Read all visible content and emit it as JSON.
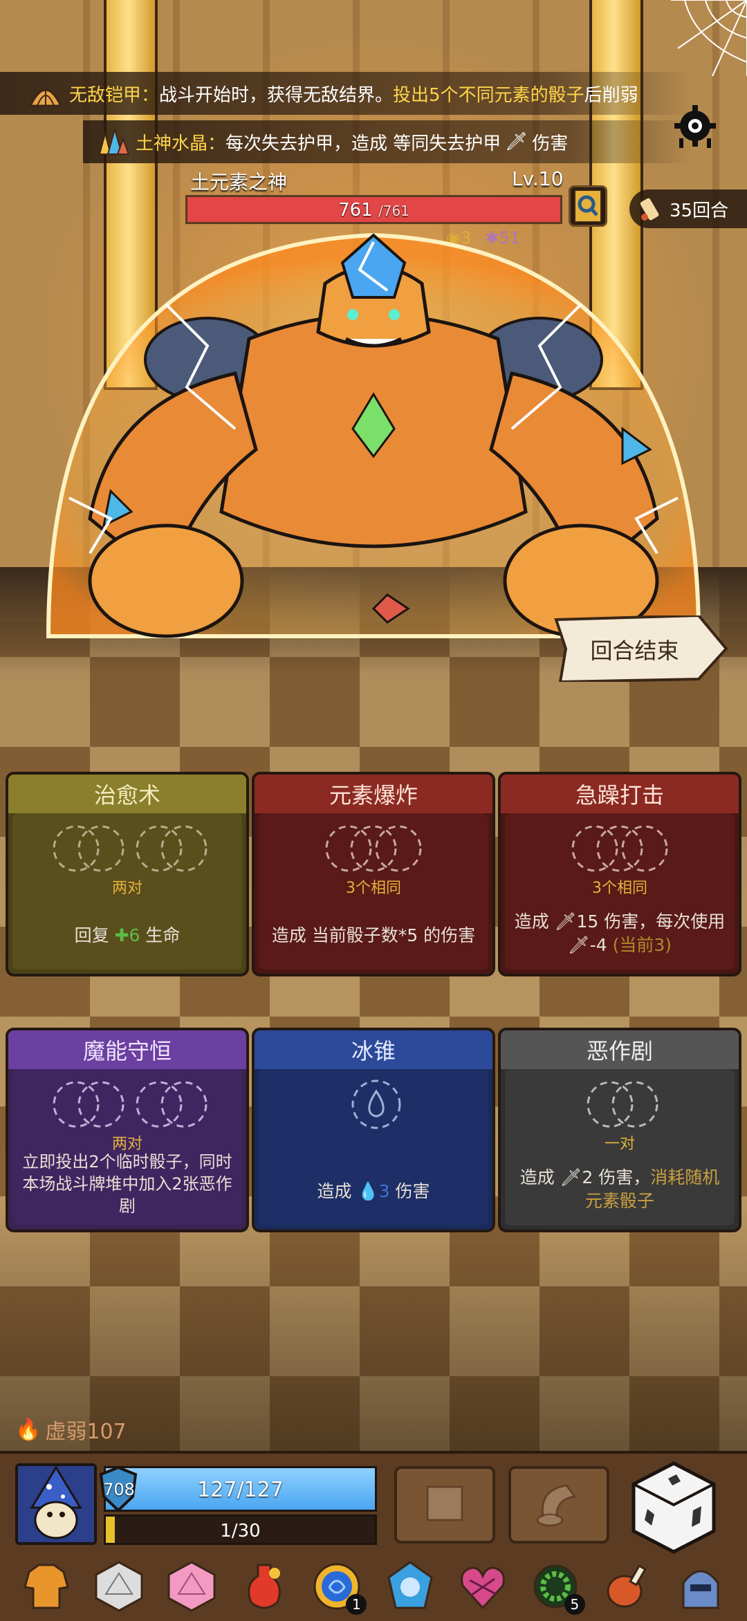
{
  "effects": [
    {
      "icon": "shell-armor-icon",
      "name": "无敌铠甲：",
      "text_before": "战斗开始时，获得无敌结界。",
      "highlight": "投出5个不同元素的骰子",
      "text_after": "后削弱"
    },
    {
      "icon": "earth-crystal-icon",
      "name": "土神水晶：",
      "text_before": "每次失去护甲，造成 等同失去护甲",
      "text_after": "伤害"
    }
  ],
  "boss": {
    "name": "土元素之神",
    "level": "Lv.10",
    "hp_current": "761",
    "hp_max": "/761",
    "hp_fraction": 1.0
  },
  "round": {
    "label": "35回合"
  },
  "boss_status": [
    {
      "icon": "armor-status-icon",
      "value": "3"
    },
    {
      "icon": "splash-status-icon",
      "value": "51"
    }
  ],
  "end_turn_label": "回合结束",
  "cards": [
    {
      "title": "治愈术",
      "condition": "两对",
      "desc_before": "回复 ",
      "desc_value": "6",
      "desc_after": " 生命"
    },
    {
      "title": "元素爆炸",
      "condition": "3个相同",
      "desc": "造成 当前骰子数*5 的伤害"
    },
    {
      "title": "急躁打击",
      "condition": "3个相同",
      "desc_line1": "造成 ",
      "desc_value": "15",
      "desc_line1_after": " 伤害，每次使用",
      "desc_line2": "-4",
      "desc_note": "(当前3)"
    },
    {
      "title": "魔能守恒",
      "condition": "两对",
      "desc": "立即投出2个临时骰子，同时本场战斗牌堆中加入2张恶作剧"
    },
    {
      "title": "冰锥",
      "desc_before": "造成 ",
      "desc_value": "3",
      "desc_after": " 伤害"
    },
    {
      "title": "恶作剧",
      "condition": "一对",
      "desc_before": "造成 ",
      "desc_value": "2",
      "desc_mid": " 伤害，",
      "desc_hl": "消耗随机元素骰子"
    }
  ],
  "weak_label": "虚弱107",
  "player": {
    "shield": "708",
    "hp_text": "127/127",
    "hp_fraction": 1.0,
    "xp_text": "1/30",
    "xp_fraction": 0.033
  },
  "relics": [
    {
      "icon": "sweater-icon",
      "badge": ""
    },
    {
      "icon": "white-d20-icon",
      "badge": ""
    },
    {
      "icon": "pink-d20-icon",
      "badge": ""
    },
    {
      "icon": "red-potion-icon",
      "badge": ""
    },
    {
      "icon": "blue-orb-icon",
      "badge": "1"
    },
    {
      "icon": "blue-gem-skull-icon",
      "badge": ""
    },
    {
      "icon": "cursed-heart-icon",
      "badge": ""
    },
    {
      "icon": "green-ring-icon",
      "badge": "5"
    },
    {
      "icon": "meat-leg-icon",
      "badge": ""
    },
    {
      "icon": "armor-helmet-icon",
      "badge": ""
    }
  ]
}
